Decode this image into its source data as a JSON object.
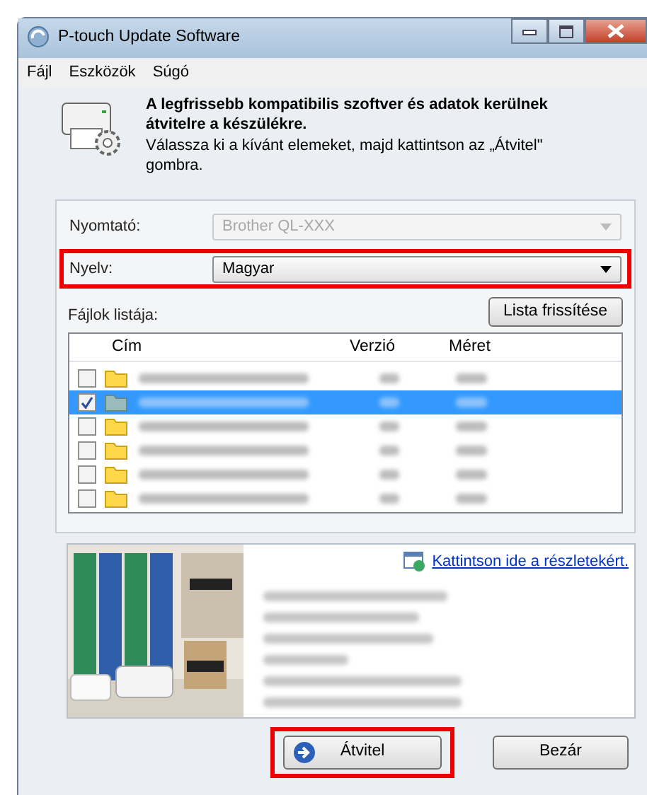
{
  "window": {
    "title": "P-touch Update Software"
  },
  "menu": [
    "Fájl",
    "Eszközök",
    "Súgó"
  ],
  "header": {
    "headline": "A legfrissebb kompatibilis szoftver és adatok kerülnek átvitelre a készülékre.",
    "instruction": "Válassza ki a kívánt elemeket, majd kattintson az „Átvitel\" gombra."
  },
  "fields": [
    {
      "label": "Nyomtató:",
      "value": "Brother QL-XXX",
      "disabled": true,
      "highlighted": false
    },
    {
      "label": "Nyelv:",
      "value": "Magyar",
      "disabled": false,
      "highlighted": true
    }
  ],
  "file_list": {
    "label": "Fájlok listája:",
    "refresh_button": "Lista frissítése",
    "columns": [
      "Cím",
      "Verzió",
      "Méret"
    ],
    "rows": [
      {
        "checked": false,
        "selected": false
      },
      {
        "checked": true,
        "selected": true
      },
      {
        "checked": false,
        "selected": false
      },
      {
        "checked": false,
        "selected": false
      },
      {
        "checked": false,
        "selected": false
      },
      {
        "checked": false,
        "selected": false
      }
    ]
  },
  "details": {
    "link": "Kattintson ide a részletekért."
  },
  "buttons": [
    {
      "label": "Átvitel",
      "highlighted": true
    },
    {
      "label": "Bezár",
      "highlighted": false
    }
  ]
}
